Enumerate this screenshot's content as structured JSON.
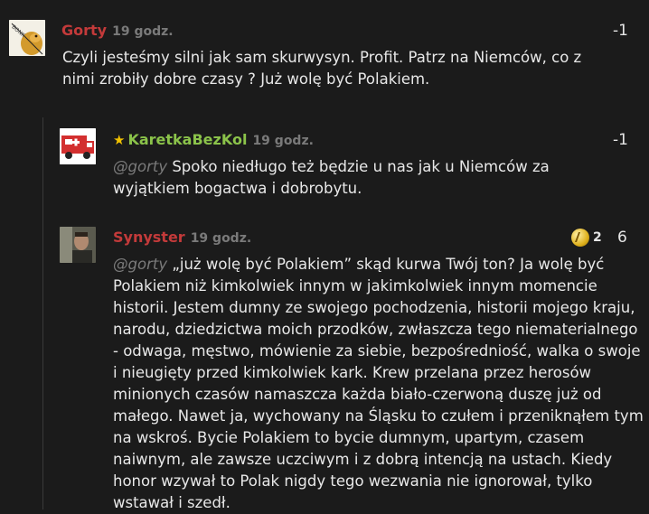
{
  "comments": [
    {
      "author": "Gorty",
      "time": "19 godz.",
      "score": "-1",
      "text": "Czyli jesteśmy silni jak sam skurwysyn. Profit. Patrz na Niemców, co z nimi zrobiły dobre czasy ? Już wolę być Polakiem.",
      "avatar_label": "BONK"
    },
    {
      "author": "KaretkaBezKol",
      "time": "19 godz.",
      "score": "-1",
      "mention": "@gorty",
      "text": " Spoko niedługo też będzie u nas jak u Niemców za wyjątkiem bogactwa i dobrobytu."
    },
    {
      "author": "Synyster",
      "time": "19 godz.",
      "score": "6",
      "badge_count": "2",
      "mention": "@gorty",
      "text": " „już wolę być Polakiem” skąd kurwa Twój ton? Ja wolę być Polakiem niż kimkolwiek innym w jakimkolwiek innym momencie historii. Jestem dumny ze swojego pochodzenia, historii mojego kraju, narodu, dziedzictwa moich przodków, zwłaszcza tego niematerialnego - odwaga, męstwo, mówienie za siebie, bezpośredniość, walka o swoje i nieugięty przed kimkolwiek kark. Krew przelana przez herosów minionych czasów namaszcza każda biało-czerwoną duszę już od małego. Nawet ja, wychowany na Śląsku to czułem i przeniknąłem tym na wskroś. Bycie Polakiem to bycie dumnym, upartym, czasem naiwnym, ale zawsze uczciwym i z dobrą intencją na ustach. Kiedy honor wzywał to Polak nigdy tego wezwania nie ignorował, tylko wstawał i szedł."
    }
  ]
}
